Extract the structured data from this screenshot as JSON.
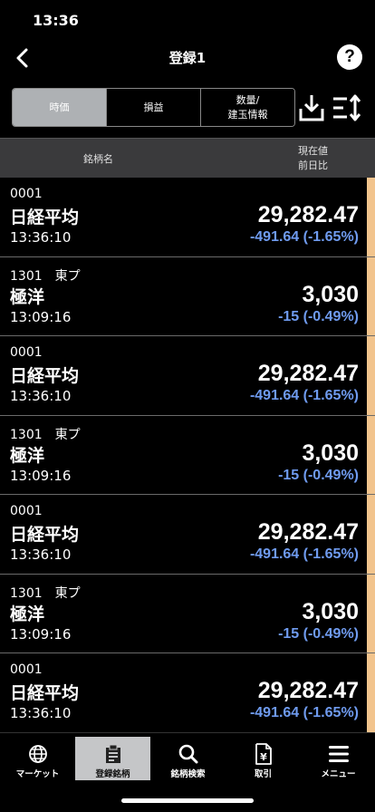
{
  "status_bar": {
    "time": "13:36"
  },
  "nav": {
    "title": "登録1",
    "help_label": "?"
  },
  "segments": [
    {
      "line1": "時価",
      "line2": "",
      "active": true
    },
    {
      "line1": "損益",
      "line2": "",
      "active": false
    },
    {
      "line1": "数量/",
      "line2": "建玉情報",
      "active": false
    }
  ],
  "columns": {
    "name": "銘柄名",
    "price_line1": "現在値",
    "price_line2": "前日比"
  },
  "rows": [
    {
      "code": "0001",
      "market": "",
      "name": "日経平均",
      "time": "13:36:10",
      "price": "29,282.47",
      "change": "-491.64 (-1.65%)"
    },
    {
      "code": "1301",
      "market": "東プ",
      "name": "極洋",
      "time": "13:09:16",
      "price": "3,030",
      "change": "-15 (-0.49%)"
    },
    {
      "code": "0001",
      "market": "",
      "name": "日経平均",
      "time": "13:36:10",
      "price": "29,282.47",
      "change": "-491.64 (-1.65%)"
    },
    {
      "code": "1301",
      "market": "東プ",
      "name": "極洋",
      "time": "13:09:16",
      "price": "3,030",
      "change": "-15 (-0.49%)"
    },
    {
      "code": "0001",
      "market": "",
      "name": "日経平均",
      "time": "13:36:10",
      "price": "29,282.47",
      "change": "-491.64 (-1.65%)"
    },
    {
      "code": "1301",
      "market": "東プ",
      "name": "極洋",
      "time": "13:09:16",
      "price": "3,030",
      "change": "-15 (-0.49%)"
    },
    {
      "code": "0001",
      "market": "",
      "name": "日経平均",
      "time": "13:36:10",
      "price": "29,282.47",
      "change": "-491.64 (-1.65%)"
    }
  ],
  "tabs": [
    {
      "label": "マーケット",
      "icon": "globe-icon",
      "active": false
    },
    {
      "label": "登録銘柄",
      "icon": "clipboard-icon",
      "active": true
    },
    {
      "label": "銘柄検索",
      "icon": "search-icon",
      "active": false
    },
    {
      "label": "取引",
      "icon": "yen-document-icon",
      "active": false
    },
    {
      "label": "メニュー",
      "icon": "hamburger-menu-icon",
      "active": false
    }
  ],
  "colors": {
    "accent": "#f2c48d",
    "negative": "#6f9bef",
    "active_segment": "#aeb1b4",
    "header_bg": "#3a3a3c"
  }
}
